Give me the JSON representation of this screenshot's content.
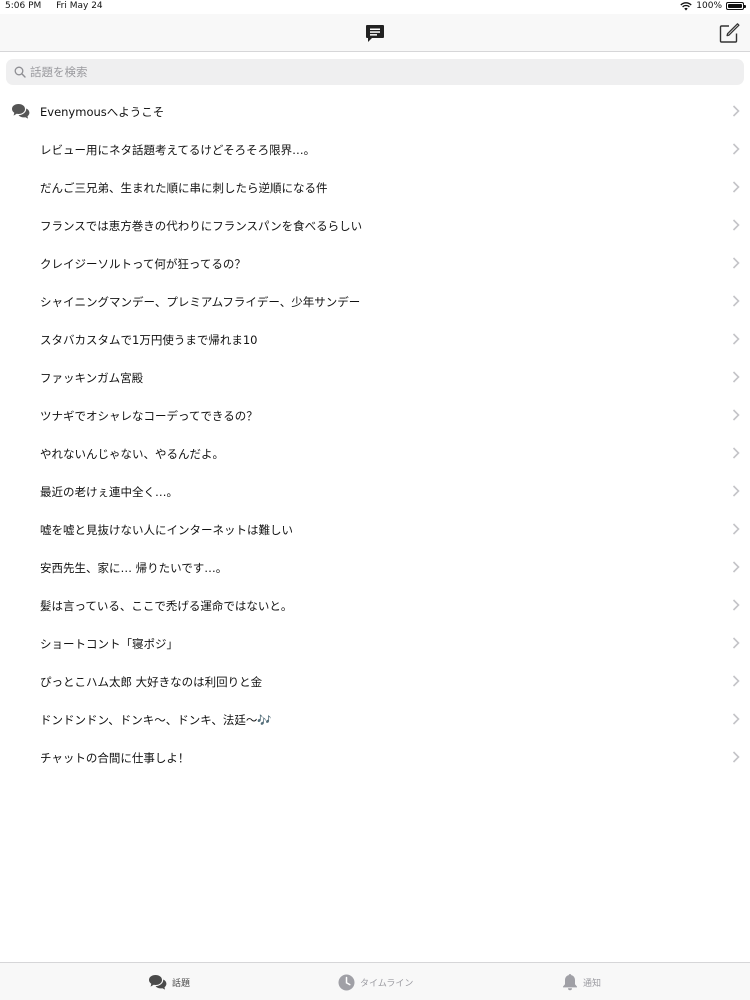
{
  "status_bar": {
    "time": "5:06 PM",
    "date": "Fri May 24",
    "battery": "100%"
  },
  "nav": {
    "title_icon": "chat-bubble-icon",
    "compose_icon": "compose-icon"
  },
  "search": {
    "placeholder": "話題を検索",
    "value": ""
  },
  "topics": [
    {
      "label": "Evenymousへようこそ",
      "icon": "chat-bubbles-icon"
    },
    {
      "label": "レビュー用にネタ話題考えてるけどそろそろ限界…。"
    },
    {
      "label": "だんご三兄弟、生まれた順に串に刺したら逆順になる件"
    },
    {
      "label": "フランスでは恵方巻きの代わりにフランスパンを食べるらしい"
    },
    {
      "label": "クレイジーソルトって何が狂ってるの？"
    },
    {
      "label": "シャイニングマンデー、プレミアムフライデー、少年サンデー"
    },
    {
      "label": "スタバカスタムで1万円使うまで帰れま10"
    },
    {
      "label": "ファッキンガム宮殿"
    },
    {
      "label": "ツナギでオシャレなコーデってできるの？"
    },
    {
      "label": "やれないんじゃない、やるんだよ。"
    },
    {
      "label": "最近の老けぇ連中全く…。"
    },
    {
      "label": "嘘を嘘と見抜けない人にインターネットは難しい"
    },
    {
      "label": "安西先生、家に… 帰りたいです…。"
    },
    {
      "label": "髪は言っている、ここで禿げる運命ではないと。"
    },
    {
      "label": "ショートコント「寝ポジ」"
    },
    {
      "label": "ぴっとこハム太郎 大好きなのは利回りと金"
    },
    {
      "label": "ドンドンドン、ドンキ〜、ドンキ、法廷〜🎶"
    },
    {
      "label": "チャットの合間に仕事しよ！"
    }
  ],
  "tabs": [
    {
      "label": "話題",
      "icon": "chat-bubbles-icon",
      "active": true
    },
    {
      "label": "タイムライン",
      "icon": "clock-icon",
      "active": false
    },
    {
      "label": "通知",
      "icon": "bell-icon",
      "active": false
    }
  ],
  "colors": {
    "background": "#ffffff",
    "bar_background": "#f8f8f8",
    "separator": "#d6d6d8",
    "search_background": "#efeff0",
    "chevron": "#c4c4c8",
    "tab_active": "#4a4a4a",
    "tab_inactive": "#9a9aa0"
  }
}
